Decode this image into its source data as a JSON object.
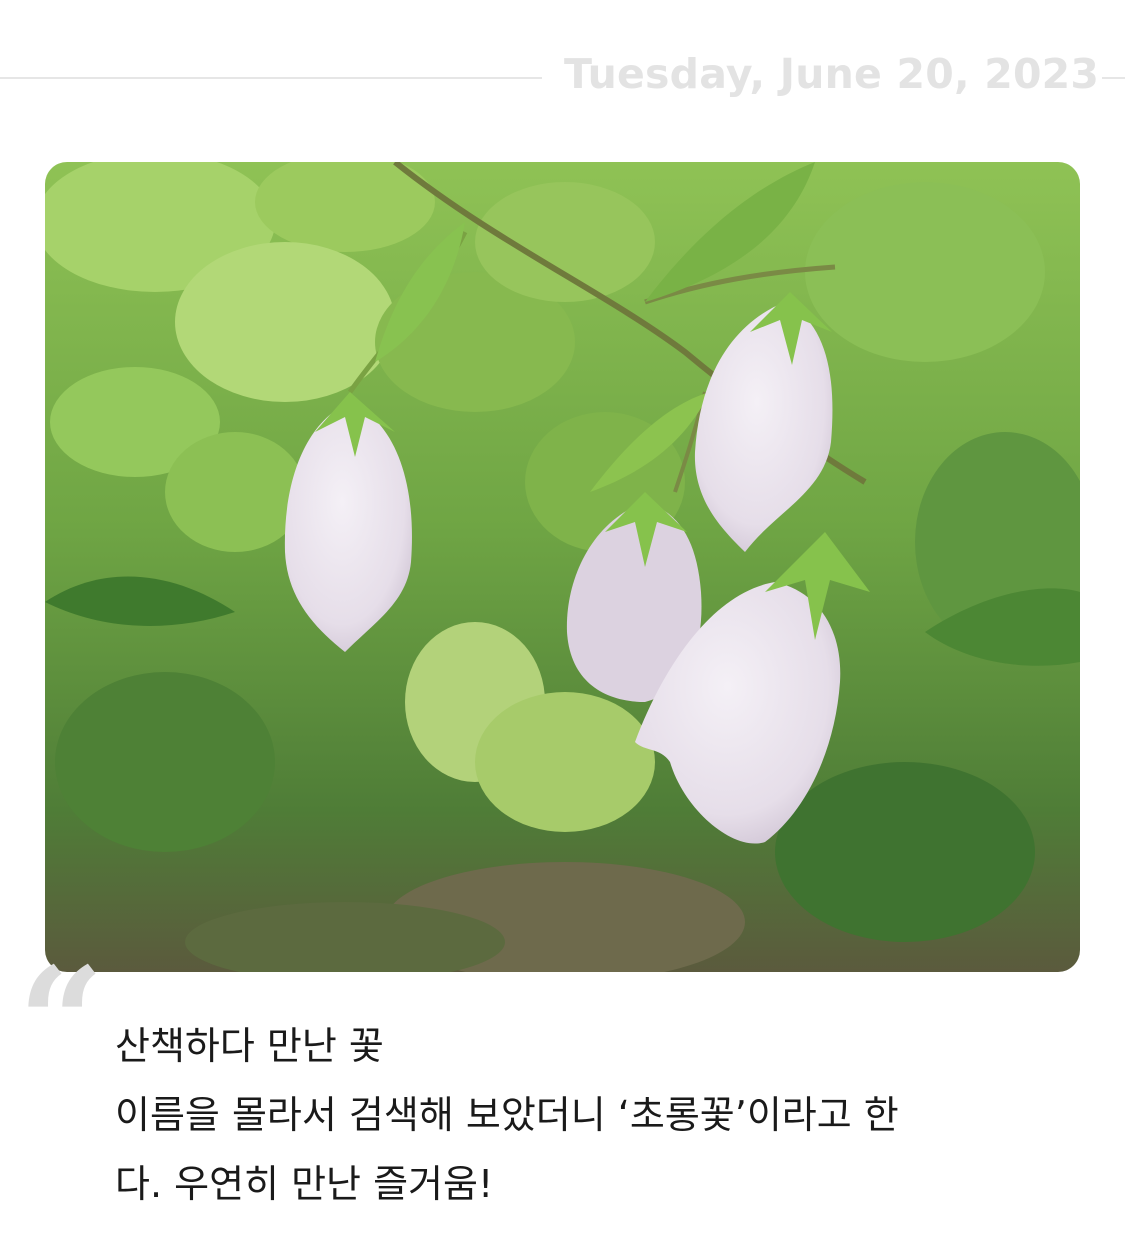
{
  "entry": {
    "date": "Tuesday, June 20, 2023",
    "photo": {
      "icon": "photo-flower-image"
    },
    "quote_icon": "quote-mark-icon",
    "lines": [
      "산책하다 만난 꽃",
      "이름을 몰라서 검색해 보았더니 ‘초롱꽃’이라고 한",
      "다. 우연히 만난 즐거움!"
    ]
  },
  "colors": {
    "date_text": "#e3e3e3",
    "body_text": "#1a1a1a",
    "quote_mark": "#dcdcdc"
  }
}
